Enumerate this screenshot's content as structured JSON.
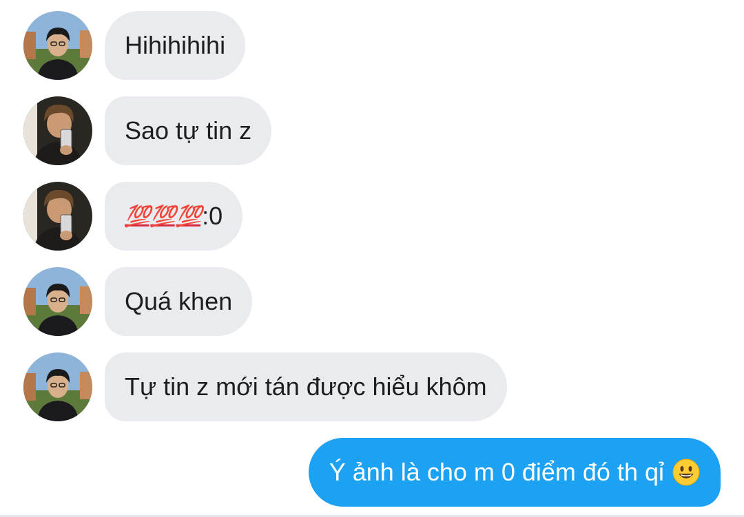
{
  "conversation": {
    "messages": [
      {
        "sender": "them",
        "avatar": "avatar-glasses-man",
        "text": "Hihihihihi"
      },
      {
        "sender": "them",
        "avatar": "avatar-mirror-selfie",
        "text": "Sao tự tin z"
      },
      {
        "sender": "them",
        "avatar": "avatar-mirror-selfie",
        "emoji": [
          "💯",
          "💯",
          "💯"
        ],
        "text": ":0"
      },
      {
        "sender": "them",
        "avatar": "avatar-glasses-man",
        "text": "Quá khen"
      },
      {
        "sender": "them",
        "avatar": "avatar-glasses-man",
        "text": "Tự tin z mới tán được hiểu khôm"
      },
      {
        "sender": "me",
        "text": "Ý ảnh là cho m 0 điểm đó th qỉ",
        "emoji": "grinning-face"
      }
    ]
  },
  "colors": {
    "incoming_bubble": "#e9ebee",
    "outgoing_bubble": "#1da1f2",
    "background": "#ffffff"
  }
}
